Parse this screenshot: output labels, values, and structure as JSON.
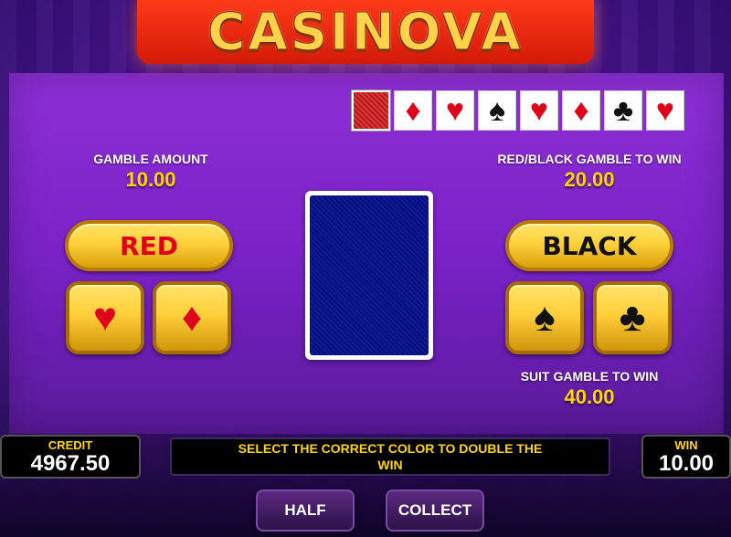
{
  "logo": {
    "text": "CASINOVA"
  },
  "history": [
    {
      "kind": "back",
      "icon": "card-back-icon",
      "glyph": ""
    },
    {
      "kind": "red",
      "icon": "diamond-icon",
      "glyph": "♦"
    },
    {
      "kind": "red",
      "icon": "heart-icon",
      "glyph": "♥"
    },
    {
      "kind": "black",
      "icon": "spade-icon",
      "glyph": "♠"
    },
    {
      "kind": "red",
      "icon": "heart-icon",
      "glyph": "♥"
    },
    {
      "kind": "red",
      "icon": "diamond-icon",
      "glyph": "♦"
    },
    {
      "kind": "black",
      "icon": "club-icon",
      "glyph": "♣"
    },
    {
      "kind": "red",
      "icon": "heart-icon",
      "glyph": "♥"
    }
  ],
  "gamble_amount": {
    "label": "GAMBLE AMOUNT",
    "value": "10.00"
  },
  "red_black": {
    "label": "RED/BLACK GAMBLE TO WIN",
    "value": "20.00"
  },
  "suit_gamble": {
    "label": "SUIT GAMBLE TO WIN",
    "value": "40.00"
  },
  "buttons": {
    "red": "RED",
    "black": "BLACK",
    "half": "HALF",
    "collect": "COLLECT"
  },
  "suits": {
    "heart": "♥",
    "diamond": "♦",
    "spade": "♠",
    "club": "♣"
  },
  "credit": {
    "label": "CREDIT",
    "value": "4967.50"
  },
  "win": {
    "label": "WIN",
    "value": "10.00"
  },
  "message": "SELECT THE CORRECT COLOR TO DOUBLE THE WIN",
  "colors": {
    "accent": "#ffd600",
    "red_suit": "#e0001a",
    "panel": "#7a22c8"
  }
}
